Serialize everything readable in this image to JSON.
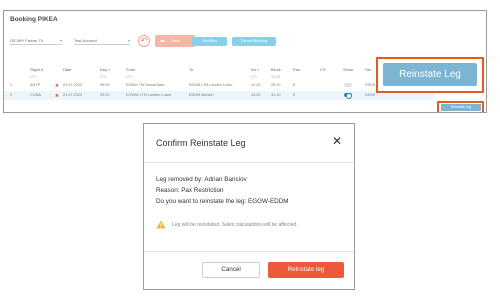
{
  "booking": {
    "title": "Booking PIKEA",
    "aircraft_select": "OE-MIY Falcon 7X",
    "account_select": "Test Account",
    "save_label": "Save",
    "modified_label": "Modified",
    "cancel_booking_label": "Cancel Booking"
  },
  "table": {
    "headers": [
      "Flight #",
      "Date",
      "Dep t",
      "From",
      "To",
      "Arr t",
      "Block",
      "Pax",
      "CS",
      "Show",
      "Sto"
    ],
    "subheaders": [
      "LTV",
      "LTV",
      "LTV",
      "LTV",
      "00:25"
    ],
    "rows": [
      {
        "num": "1",
        "flight": "AHYP",
        "date": "21.07.2023",
        "dep": "09:00",
        "from": "EDMM 7fb Nomal Aiter...",
        "to": "EDDM LTN London Luton",
        "arr": "11:10",
        "block": "29:10",
        "pax": "8",
        "sto": "SSSS"
      },
      {
        "num": "2",
        "flight": "CONA",
        "date": "21.07.2023",
        "dep": "09:00",
        "from": "EGWW LTN London Luton",
        "to": "EDDM Munich",
        "arr": "12:20",
        "block": "31:10",
        "pax": "0",
        "sto": "SSSS"
      }
    ],
    "row_button_label": "Reinstate Leg"
  },
  "callout": {
    "label": "Reinstate Leg"
  },
  "dialog": {
    "title": "Confirm Reinstate Leg",
    "removed_by": "Leg removed by: Adrian Banciov",
    "reason": "Reason: Pax Restriction",
    "question": "Do you want to reinstate the leg: EGGW-EDDM",
    "warning": "Leg will be reinstated. Sales calculations will be affected.",
    "cancel_label": "Cancel",
    "confirm_label": "Reinstate leg"
  },
  "colors": {
    "accent_orange": "#ec5a3b",
    "highlight": "#e45a22",
    "blue_button": "#7cb5d3",
    "toggle_blue": "#2b83c2"
  }
}
